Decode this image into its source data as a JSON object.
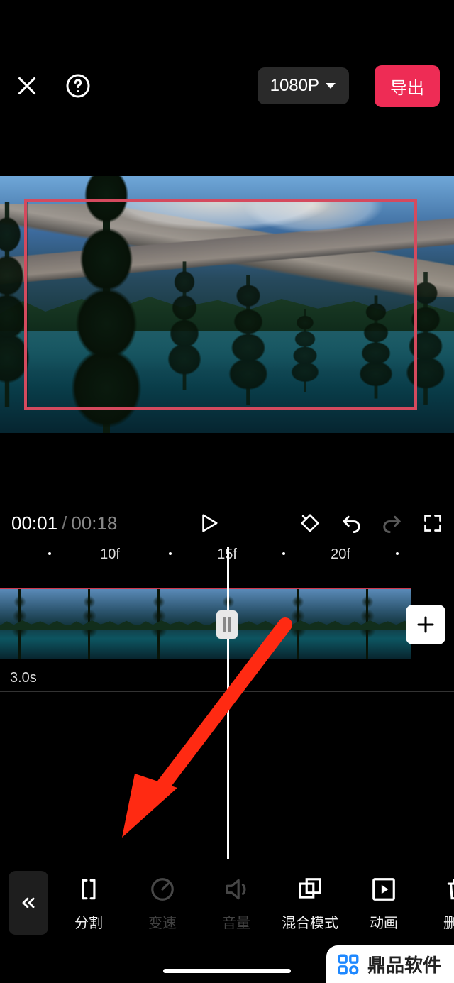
{
  "header": {
    "resolution_label": "1080P",
    "export_label": "导出"
  },
  "playback": {
    "current_time": "00:01",
    "total_time": "00:18"
  },
  "ruler": {
    "marks": [
      "10f",
      "15f",
      "20f"
    ]
  },
  "track": {
    "duration_label": "3.0s"
  },
  "toolbar": {
    "items": [
      {
        "id": "split",
        "label": "分割",
        "disabled": false
      },
      {
        "id": "speed",
        "label": "变速",
        "disabled": true
      },
      {
        "id": "volume",
        "label": "音量",
        "disabled": true
      },
      {
        "id": "blend",
        "label": "混合模式",
        "disabled": false
      },
      {
        "id": "animation",
        "label": "动画",
        "disabled": false
      },
      {
        "id": "delete",
        "label": "删除",
        "disabled": false
      }
    ]
  },
  "watermark": {
    "text": "鼎品软件"
  }
}
